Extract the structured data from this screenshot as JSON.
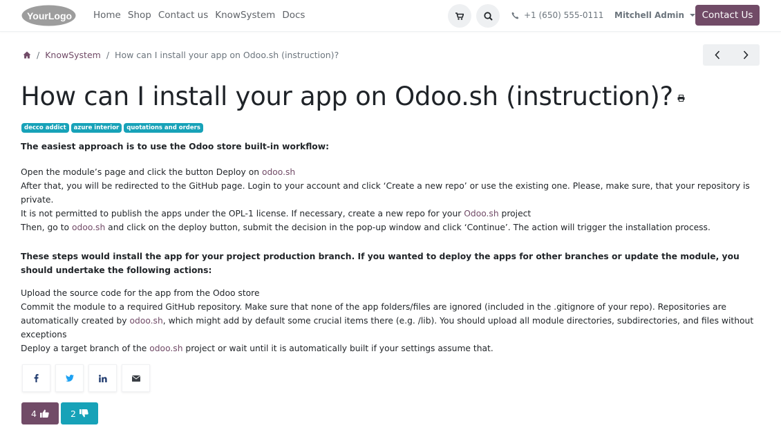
{
  "header": {
    "logo_text": "YourLogo",
    "nav": [
      "Home",
      "Shop",
      "Contact us",
      "KnowSystem",
      "Docs"
    ],
    "phone": "+1 (650) 555-0111",
    "user": "Mitchell Admin",
    "contact_button": "Contact Us"
  },
  "breadcrumb": {
    "sep": "/",
    "section": "KnowSystem",
    "current": "How can I install your app on Odoo.sh (instruction)?"
  },
  "article": {
    "title": "How can I install your app on Odoo.sh (instruction)?",
    "tags": [
      "decco addict",
      "azure interior",
      "quotations and orders"
    ],
    "heading1": "The easiest approach is to use the Odoo store built-in workflow:",
    "p1_a": "Open the module’s page and click the button Deploy on ",
    "p1_link": "odoo.sh",
    "p2": "After that, you will be redirected to the GitHub page. Login to your account and click ‘Create a new repo’ or use the existing one. Please, make sure, that your repository is private.",
    "p3_a": "It is not permitted to publish the apps under the OPL-1 license. If necessary, create a new repo for your ",
    "p3_link": "Odoo.sh",
    "p3_b": " project",
    "p4_a": "Then, go to ",
    "p4_link": "odoo.sh",
    "p4_b": " and click on the deploy button, submit the decision in the pop-up window and click ‘Continue’. The action will trigger the installation process.",
    "heading2": "These steps would install the app for your project production branch. If you wanted to deploy the apps for other branches or update the module, you should undertake the following actions:",
    "q1": "Upload the source code for the app from the Odoo store",
    "q2_a": "Commit the module to a required GitHub repository. Make sure that none of the app folders/files are ignored (included in the .gitignore of your repo). Repositories are automatically created by ",
    "q2_link": "odoo.sh",
    "q2_b": ", which might add by default some crucial items there (e.g. /lib). You should upload all module directories, subdirectories, and files without exceptions",
    "q3_a": "Deploy a target branch of the ",
    "q3_link": "odoo.sh",
    "q3_b": " project or wait until it is automatically built if your settings assume that."
  },
  "votes": {
    "likes": "4",
    "dislikes": "2"
  },
  "colors": {
    "primary": "#714b67",
    "info": "#17a2b8"
  }
}
